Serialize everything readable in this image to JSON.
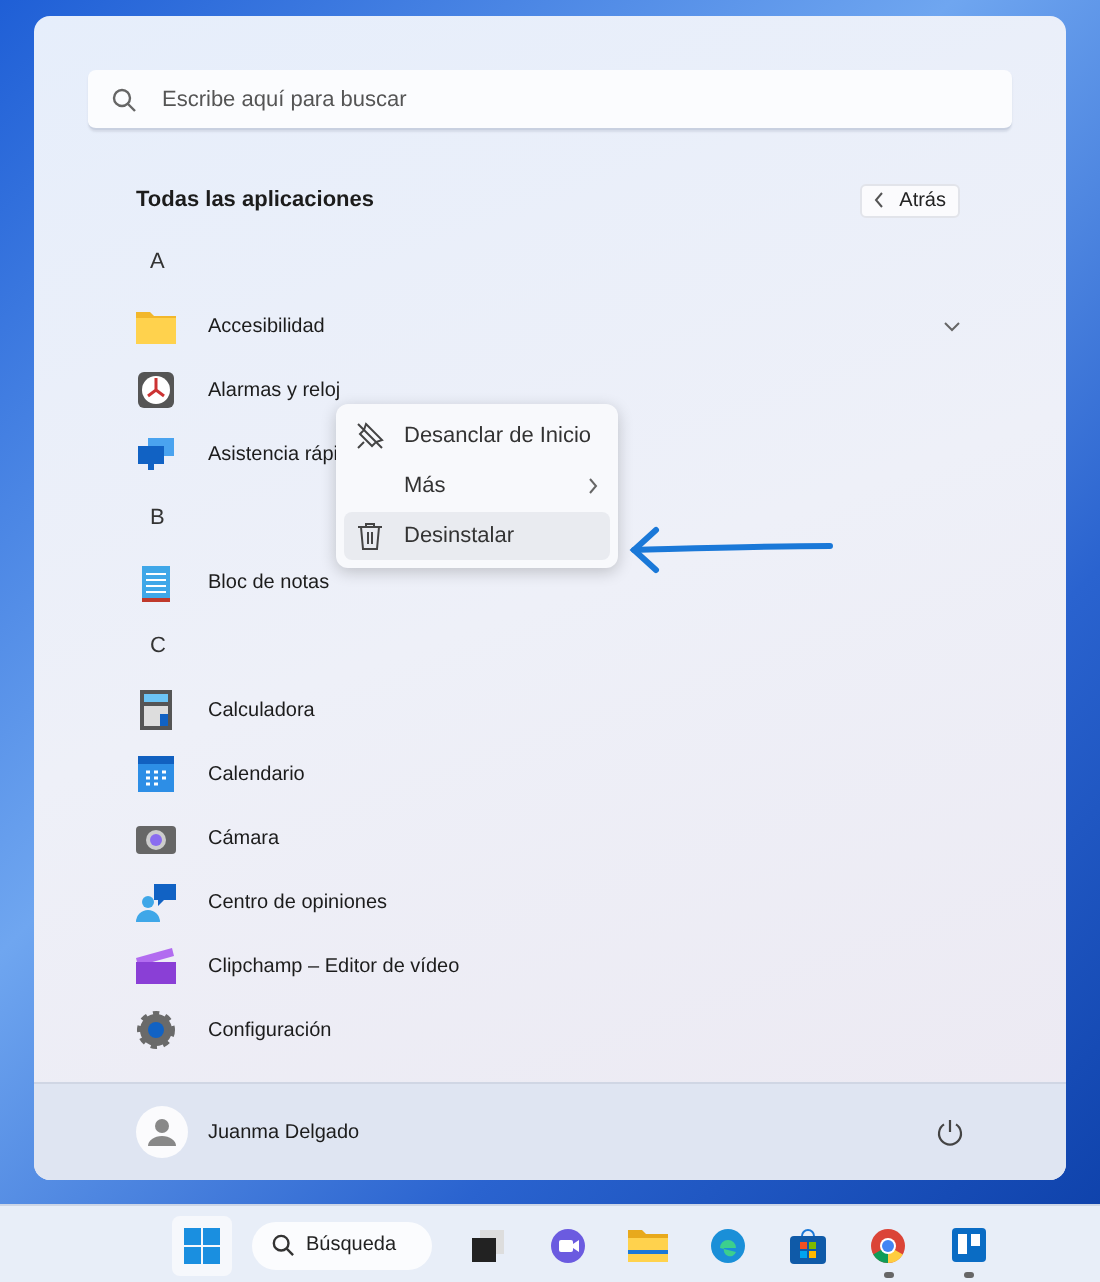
{
  "search": {
    "placeholder": "Escribe aquí para buscar"
  },
  "header": {
    "title": "Todas las aplicaciones",
    "back_button": "Atrás"
  },
  "apps": [
    {
      "kind": "letter",
      "label": "A"
    },
    {
      "kind": "app",
      "label": "Accesibilidad",
      "expanded": false
    },
    {
      "kind": "app",
      "label": "Alarmas y reloj"
    },
    {
      "kind": "app",
      "label": "Asistencia rápi"
    },
    {
      "kind": "letter",
      "label": "B"
    },
    {
      "kind": "app",
      "label": "Bloc de notas"
    },
    {
      "kind": "letter",
      "label": "C"
    },
    {
      "kind": "app",
      "label": "Calculadora"
    },
    {
      "kind": "app",
      "label": "Calendario"
    },
    {
      "kind": "app",
      "label": "Cámara"
    },
    {
      "kind": "app",
      "label": "Centro de opiniones"
    },
    {
      "kind": "app",
      "label": "Clipchamp – Editor de vídeo"
    },
    {
      "kind": "app",
      "label": "Configuración"
    }
  ],
  "context_menu": [
    {
      "label": "Desanclar de Inicio",
      "kind": "action",
      "selected": false
    },
    {
      "label": "Más",
      "kind": "submenu",
      "selected": false
    },
    {
      "label": "Desinstalar",
      "kind": "action",
      "selected": true
    }
  ],
  "user": {
    "name": "Juanma Delgado"
  },
  "taskbar": {
    "search": "Búsqueda",
    "apps": [
      {
        "running": false
      },
      {
        "running": false
      },
      {
        "running": false
      },
      {
        "running": false
      },
      {
        "running": false
      },
      {
        "running": true
      },
      {
        "running": true
      }
    ]
  }
}
